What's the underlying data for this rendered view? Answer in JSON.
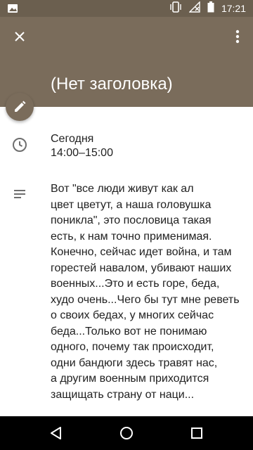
{
  "status_bar": {
    "time": "17:21",
    "icons": [
      "image-icon",
      "vibrate-icon",
      "no-signal-icon",
      "battery-icon"
    ]
  },
  "header": {
    "title": "(Нет заголовка)",
    "background": "#7a6c5b",
    "icons": [
      "close-icon",
      "more-vert-icon"
    ]
  },
  "event": {
    "date_label": "Сегодня",
    "time_range": "14:00–15:00",
    "description": "Вот \"все люди живут как ал\nцвет цветут, а наша головушка\nпоникла\", это пословица такая\nесть, к нам точно применимая.\nКонечно, сейчас идет война, и там\nгорестей навалом, убивают наших\nвоенных...Это и есть горе, беда,\nхудо очень...Чего бы тут мне реветь\nо своих бедах, у многих сейчас\nбеда...Только вот не понимаю\nодного, почему так происходит,\nодни бандюги здесь травят нас,\nа другим военным приходится\nзащищать страну от наци..."
  },
  "nav_bar": {
    "icons": [
      "back-icon",
      "home-icon",
      "recents-icon"
    ]
  }
}
